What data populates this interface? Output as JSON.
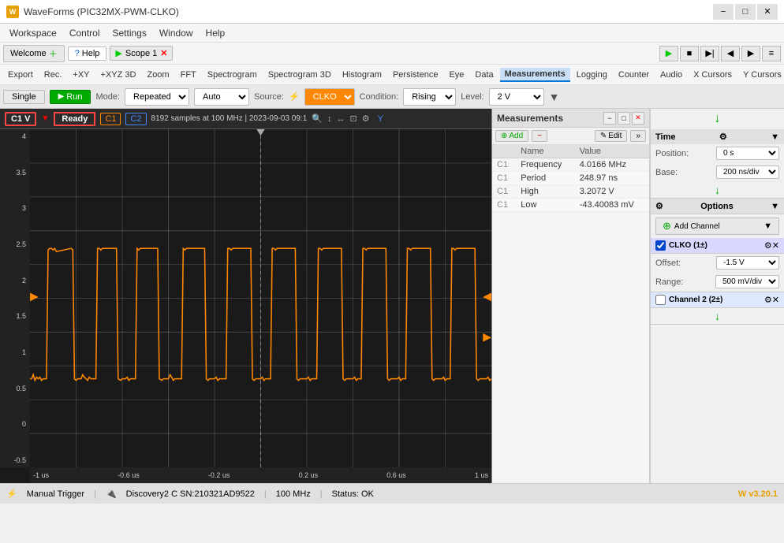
{
  "titleBar": {
    "title": "WaveForms (PIC32MX-PWM-CLKO)",
    "minBtn": "−",
    "maxBtn": "□",
    "closeBtn": "✕"
  },
  "menuBar": {
    "items": [
      "Workspace",
      "Control",
      "Settings",
      "Window",
      "Help"
    ]
  },
  "toolbar1": {
    "welcomeBtn": "Welcome",
    "helpBtn": "Help",
    "scopeTab": "Scope 1"
  },
  "toolbar2": {
    "items": [
      "Export",
      "Rec.",
      "+XY",
      "+XYZ 3D",
      "Zoom",
      "FFT",
      "Spectrogram",
      "Spectrogram 3D",
      "Histogram",
      "Persistence",
      "Eye",
      "Data",
      "Measurements",
      "Logging",
      "Counter",
      "Audio",
      "X Cursors",
      "Y Cursors"
    ],
    "active": "Measurements"
  },
  "modeBar": {
    "singleLabel": "Single",
    "runLabel": "Run",
    "modeLabel": "Mode:",
    "modeValue": "Repeated",
    "autoLabel": "Auto",
    "sourceLabel": "Source:",
    "sourceValue": "CLKO",
    "conditionLabel": "Condition:",
    "conditionValue": "Rising",
    "levelLabel": "Level:",
    "levelValue": "2 V"
  },
  "scopeInfo": {
    "ch1Label": "C1 V",
    "statusLabel": "Ready",
    "c1Badge": "C1",
    "c2Badge": "C2",
    "infoText": "8192 samples at 100 MHz | 2023-09-03 09:1"
  },
  "yAxis": {
    "labels": [
      "4",
      "3.5",
      "3",
      "2.5",
      "2",
      "1.5",
      "1",
      "0.5",
      "0",
      "-0.5"
    ]
  },
  "xAxis": {
    "labels": [
      "-1 us",
      "-0.6 us",
      "-0.2 us",
      "0.2 us",
      "0.6 us",
      "1 us"
    ]
  },
  "measurements": {
    "title": "Measurements",
    "addBtn": "+ Add",
    "removeBtn": "−",
    "editBtn": "✎ Edit",
    "columns": [
      "",
      "Name",
      "Value"
    ],
    "rows": [
      {
        "ch": "C1",
        "name": "Frequency",
        "value": "4.0166 MHz"
      },
      {
        "ch": "C1",
        "name": "Period",
        "value": "248.97 ns"
      },
      {
        "ch": "C1",
        "name": "High",
        "value": "3.2072 V"
      },
      {
        "ch": "C1",
        "name": "Low",
        "value": "-43.40083 mV"
      }
    ]
  },
  "rightPanel": {
    "timeSection": {
      "header": "Time",
      "positionLabel": "Position:",
      "positionValue": "0 s",
      "baseLabel": "Base:",
      "baseValue": "200 ns/div"
    },
    "optionsSection": {
      "header": "Options"
    },
    "addChannelBtn": "Add Channel",
    "channel1": {
      "name": "CLKO (1±)",
      "checked": true,
      "offsetLabel": "Offset:",
      "offsetValue": "-1.5 V",
      "rangeLabel": "Range:",
      "rangeValue": "500 mV/div"
    },
    "channel2": {
      "name": "Channel 2 (2±)",
      "checked": false
    }
  },
  "statusBar": {
    "triggerLabel": "Manual Trigger",
    "deviceLabel": "Discovery2 C SN:210321AD9522",
    "freqLabel": "100 MHz",
    "statusLabel": "Status: OK",
    "versionLabel": "v3.20.1"
  }
}
